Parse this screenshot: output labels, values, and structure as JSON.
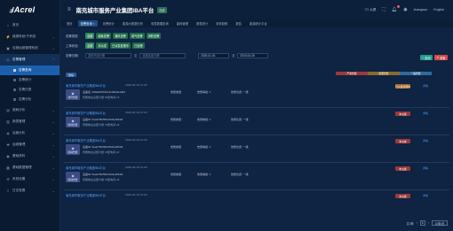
{
  "brand": {
    "logo_text": "Acrel",
    "logo_mark": "Ⅎ"
  },
  "header": {
    "title": "南充城市服务产业集团IBA平台",
    "badge": "在线",
    "right": {
      "screen": "大屏",
      "user": "zhangsan",
      "lang": "English",
      "notif_count": "1"
    }
  },
  "sidebar": {
    "items": [
      {
        "label": "首页",
        "icon": "home-icon"
      },
      {
        "label": "能源系统/子系统",
        "icon": "energy-icon"
      },
      {
        "label": "设施运维管理系统",
        "icon": "tool-icon"
      },
      {
        "label": "告警管理",
        "icon": "bell-icon"
      }
    ],
    "subitems": [
      {
        "label": "告警查询"
      },
      {
        "label": "告警统计"
      },
      {
        "label": "告警日报"
      },
      {
        "label": "告警分析"
      }
    ],
    "items2": [
      {
        "label": "能耗分析",
        "icon": "chart-icon"
      },
      {
        "label": "报表管理",
        "icon": "report-icon"
      },
      {
        "label": "运营分析",
        "icon": "analysis-icon"
      },
      {
        "label": "运维管理",
        "icon": "wrench-icon"
      },
      {
        "label": "基础资料",
        "icon": "database-icon"
      },
      {
        "label": "基础数据管理",
        "icon": "grid-icon"
      },
      {
        "label": "系统设置",
        "icon": "gear-icon"
      },
      {
        "label": "日志查看",
        "icon": "log-icon"
      }
    ]
  },
  "tabs": [
    {
      "label": "首页"
    },
    {
      "label": "告警查询",
      "active": true
    },
    {
      "label": "告警统计"
    },
    {
      "label": "能源大数据分析"
    },
    {
      "label": "电表数据查询"
    },
    {
      "label": "能耗管理"
    },
    {
      "label": "报表统计"
    },
    {
      "label": "采样趋势"
    },
    {
      "label": "报告"
    },
    {
      "label": "能源统计平台"
    }
  ],
  "filters": {
    "type_label": "告警类型:",
    "type_chips": [
      "全部",
      "能耗告警",
      "通讯告警",
      "电气告警",
      "消防告警"
    ],
    "work_label": "工单状态:",
    "work_chips": [
      "全部",
      "未派发",
      "已派发处理中",
      "已处理"
    ],
    "time_label": "告警日期:",
    "start_placeholder": "选择开始日期",
    "end_placeholder": "选择结束日期",
    "from_date": "2020-01-01",
    "to_date": "2020-04-30",
    "sep": "至",
    "query_button": "查询",
    "reset_button": "重置"
  },
  "legend": [
    "严重告警",
    "重要告警",
    "一般告警"
  ],
  "batch_button": "删除",
  "records": [
    {
      "title": "南充城市服务产业集团IBA平台",
      "time": "2020-04-19 12:20",
      "type": "通讯告警",
      "line1": "设备名: 5d9a0f105b1c3c03b0e4d0d",
      "line2": "所属物业总部大楼 5#配电间 1#",
      "m1": "告警类型:",
      "m2": "告警等级: 1",
      "m3": "告警位置: 一级",
      "tag": "已派发处理中",
      "tag_color": "orange",
      "detail": "详情"
    },
    {
      "title": "南充城市服务产业集团IBA平台",
      "time": "2020-04-19 12:20",
      "type": "能耗告警",
      "line1": "设备ID: 5ea27f5c55f4c5c0e0f34bf",
      "line2": "所属物业总部大楼 7#配电间 2#",
      "m1": "告警类型:",
      "m2": "告警等级: 1",
      "m3": "告警位置: 一级",
      "tag": "未派发",
      "tag_color": "red",
      "detail": "详情"
    },
    {
      "title": "南充城市服务产业集团IBA平台",
      "time": "2020-04-19 12:20",
      "type": "能耗告警",
      "line1": "设备ID: 5ea27f5c55f4c5c0e0f34bf",
      "line2": "所属物业总部大楼 7#配电间 2#",
      "m1": "告警类型:",
      "m2": "告警等级: 1",
      "m3": "告警位置: 一级",
      "tag": "未派发",
      "tag_color": "red",
      "detail": "详情"
    },
    {
      "title": "南充城市服务产业集团IBA平台",
      "time": "2020-04-19 12:20",
      "type": "能耗告警",
      "line1": "设备ID: 5ea27f5c55f4c5c0e0f34bf",
      "line2": "所属物业总部大楼 7#配电间 2#",
      "m1": "告警类型:",
      "m2": "告警等级: 1",
      "m3": "告警位置: 一级",
      "tag": "未派发",
      "tag_color": "red",
      "detail": "详情"
    },
    {
      "title": "南充城市服务产业集团IBA平台",
      "time": "2020-04-19 12:20",
      "type": "能耗告警",
      "line1": "",
      "line2": "",
      "m1": "",
      "m2": "",
      "m3": "",
      "tag": "未派发",
      "tag_color": "red",
      "detail": "详情"
    }
  ],
  "pager": {
    "total": "共4条",
    "page": "1",
    "size": "10条/页"
  }
}
